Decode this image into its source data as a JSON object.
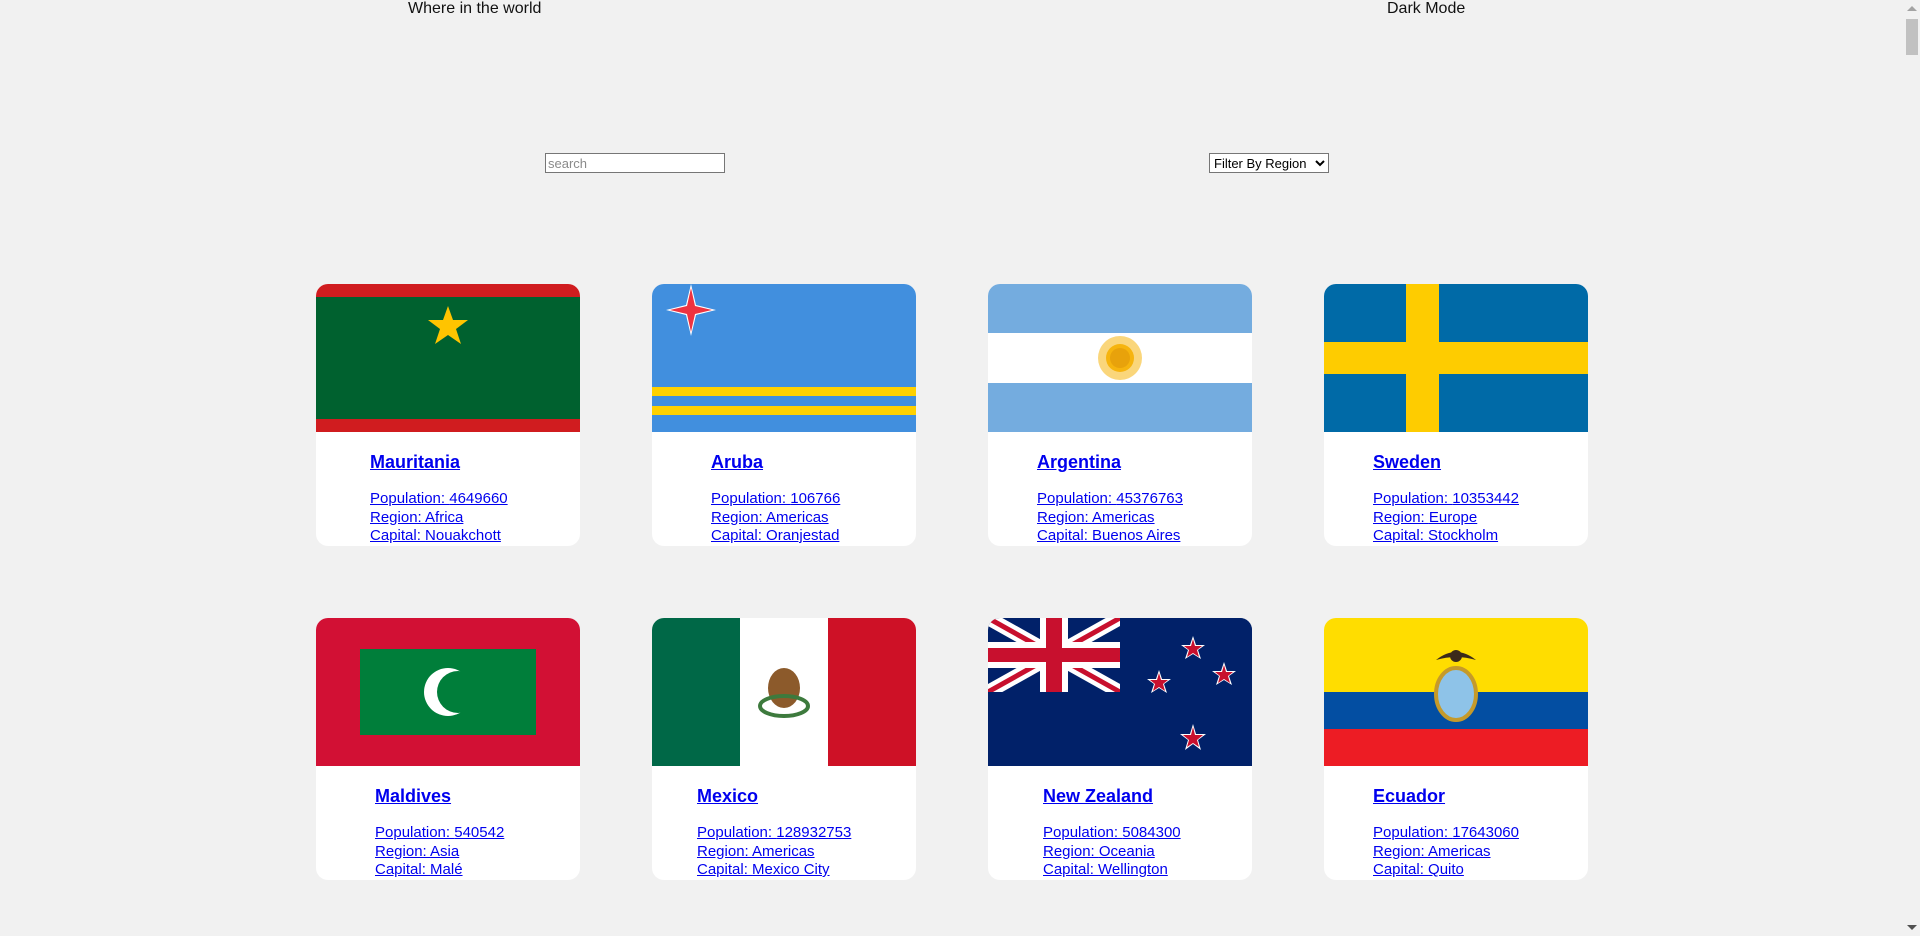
{
  "header": {
    "title": "Where in the world",
    "mode_toggle": "Dark Mode"
  },
  "search": {
    "placeholder": "search",
    "value": ""
  },
  "filter": {
    "selected": "Filter By Region"
  },
  "labels": {
    "population": "Population: ",
    "region": "Region: ",
    "capital": "Capital: "
  },
  "countries": [
    {
      "name": "Mauritania",
      "population": "4649660",
      "region": "Africa",
      "capital": "Nouakchott"
    },
    {
      "name": "Aruba",
      "population": "106766",
      "region": "Americas",
      "capital": "Oranjestad"
    },
    {
      "name": "Argentina",
      "population": "45376763",
      "region": "Americas",
      "capital": "Buenos Aires"
    },
    {
      "name": "Sweden",
      "population": "10353442",
      "region": "Europe",
      "capital": "Stockholm"
    },
    {
      "name": "Maldives",
      "population": "540542",
      "region": "Asia",
      "capital": "Malé"
    },
    {
      "name": "Mexico",
      "population": "128932753",
      "region": "Americas",
      "capital": "Mexico City"
    },
    {
      "name": "New Zealand",
      "population": "5084300",
      "region": "Oceania",
      "capital": "Wellington"
    },
    {
      "name": "Ecuador",
      "population": "17643060",
      "region": "Americas",
      "capital": "Quito"
    }
  ]
}
